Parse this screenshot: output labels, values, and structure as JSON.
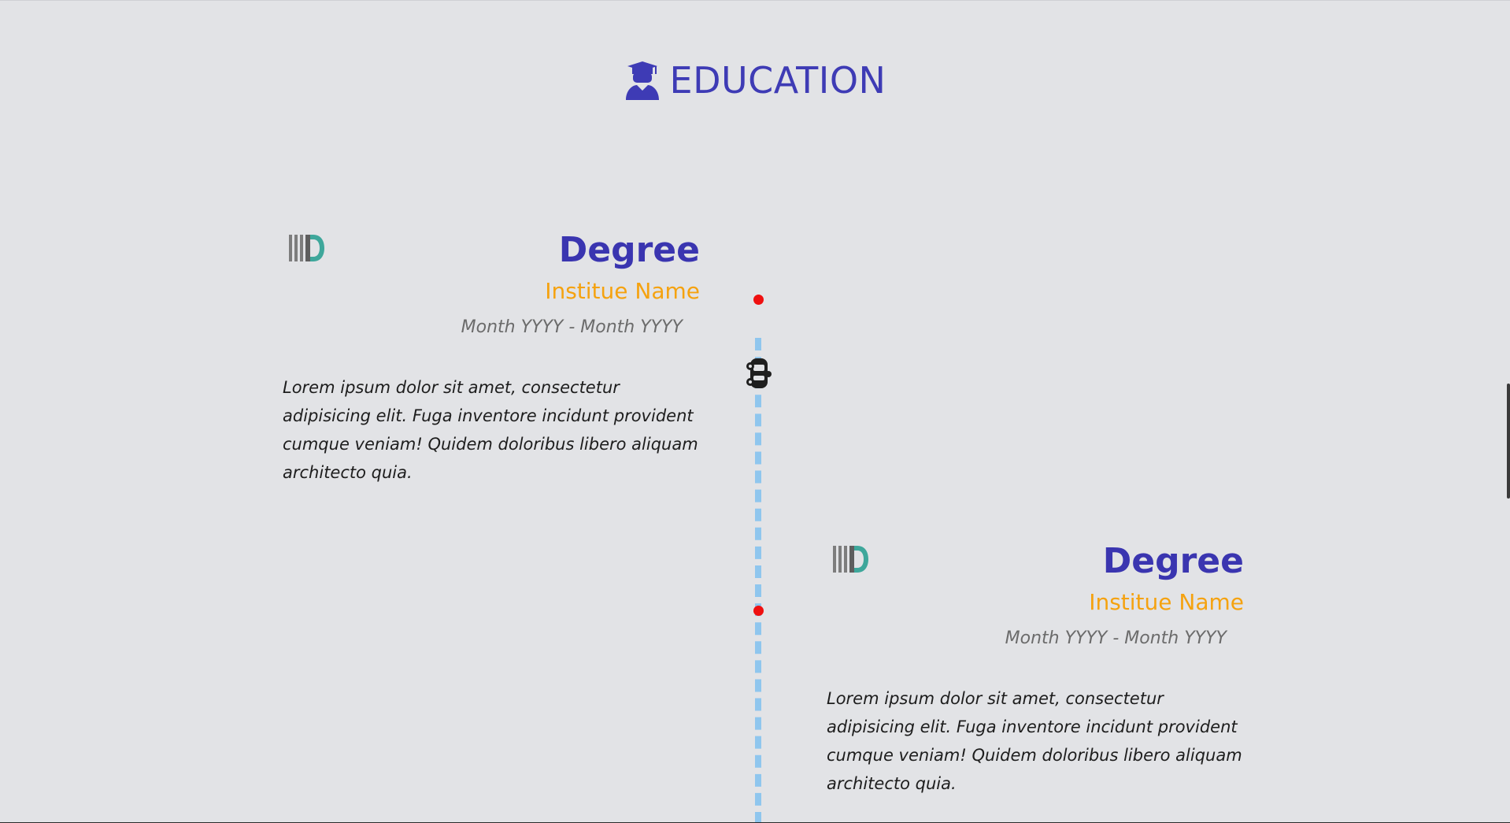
{
  "section": {
    "title": "EDUCATION",
    "icon": "graduate-icon",
    "accent_color": "#3e3bb5"
  },
  "timeline": {
    "line_color": "#8fc6ee",
    "dot_color": "#ef1010",
    "marker_icon": "car-icon"
  },
  "entries": [
    {
      "logo": "md-logo-icon",
      "degree": "Degree",
      "institute": "Institue Name",
      "dates": "Month YYYY - Month YYYY",
      "description": "Lorem ipsum dolor sit amet, consectetur adipisicing elit. Fuga inventore incidunt provident cumque veniam! Quidem doloribus libero aliquam architecto quia."
    },
    {
      "logo": "md-logo-icon",
      "degree": "Degree",
      "institute": "Institue Name",
      "dates": "Month YYYY - Month YYYY",
      "description": "Lorem ipsum dolor sit amet, consectetur adipisicing elit. Fuga inventore incidunt provident cumque veniam! Quidem doloribus libero aliquam architecto quia."
    }
  ]
}
